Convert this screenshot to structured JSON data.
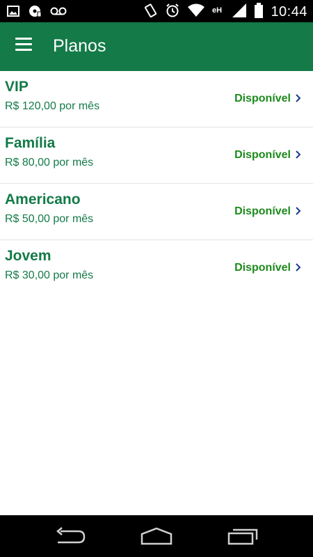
{
  "status_bar": {
    "time": "10:44",
    "left_icons": [
      "image-icon",
      "media-icon",
      "voicemail-icon"
    ],
    "right_icons": [
      "rotate-icon",
      "alarm-icon",
      "wifi-icon",
      "signal-icon",
      "battery-icon"
    ]
  },
  "app_bar": {
    "title": "Planos",
    "menu_icon": "menu-icon"
  },
  "plans": [
    {
      "name": "VIP",
      "price": "R$ 120,00 por mês",
      "status": "Disponível"
    },
    {
      "name": "Família",
      "price": "R$ 80,00 por mês",
      "status": "Disponível"
    },
    {
      "name": "Americano",
      "price": "R$ 50,00 por mês",
      "status": "Disponível"
    },
    {
      "name": "Jovem",
      "price": "R$ 30,00 por mês",
      "status": "Disponível"
    }
  ],
  "nav_bar": {
    "icons": [
      "back-icon",
      "home-icon",
      "recents-icon"
    ]
  },
  "colors": {
    "primary": "#137a48",
    "status_green": "#1c8a1c",
    "chevron": "#1a3a8a"
  }
}
